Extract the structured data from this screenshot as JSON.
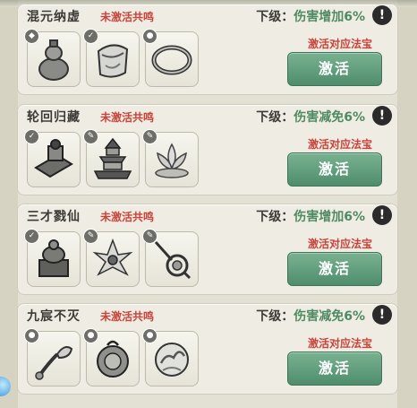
{
  "rows": [
    {
      "name": "混元纳虚",
      "status": "未激活共鸣",
      "next_label": "下级：",
      "next_effect": "伤害增加6%",
      "hint": "激活对应法宝",
      "button": "激活",
      "items": [
        {
          "icon": "gourd-vase-icon"
        },
        {
          "icon": "cloth-bag-icon"
        },
        {
          "icon": "bracelet-ring-icon"
        }
      ]
    },
    {
      "name": "轮回归藏",
      "status": "未激活共鸣",
      "next_label": "下级：",
      "next_effect": "伤害减免6%",
      "hint": "激活对应法宝",
      "button": "激活",
      "items": [
        {
          "icon": "seal-stamp-icon"
        },
        {
          "icon": "pagoda-icon"
        },
        {
          "icon": "lotus-icon"
        }
      ]
    },
    {
      "name": "三才戮仙",
      "status": "未激活共鸣",
      "next_label": "下级：",
      "next_effect": "伤害增加6%",
      "hint": "激活对应法宝",
      "button": "激活",
      "items": [
        {
          "icon": "bronze-cauldron-icon"
        },
        {
          "icon": "feather-fan-icon"
        },
        {
          "icon": "ornate-scepter-icon"
        }
      ]
    },
    {
      "name": "九宸不灭",
      "status": "未激活共鸣",
      "next_label": "下级：",
      "next_effect": "伤害减免6%",
      "hint": "激活对应法宝",
      "button": "激活",
      "items": [
        {
          "icon": "jade-ruyi-icon"
        },
        {
          "icon": "round-bell-icon"
        },
        {
          "icon": "cloud-mirror-icon"
        }
      ]
    }
  ],
  "info_icon": "!",
  "colors": {
    "status_red": "#c9433b",
    "effect_green": "#4f8a63",
    "button_green": "#5f9c7a",
    "panel_bg": "#efede3"
  }
}
